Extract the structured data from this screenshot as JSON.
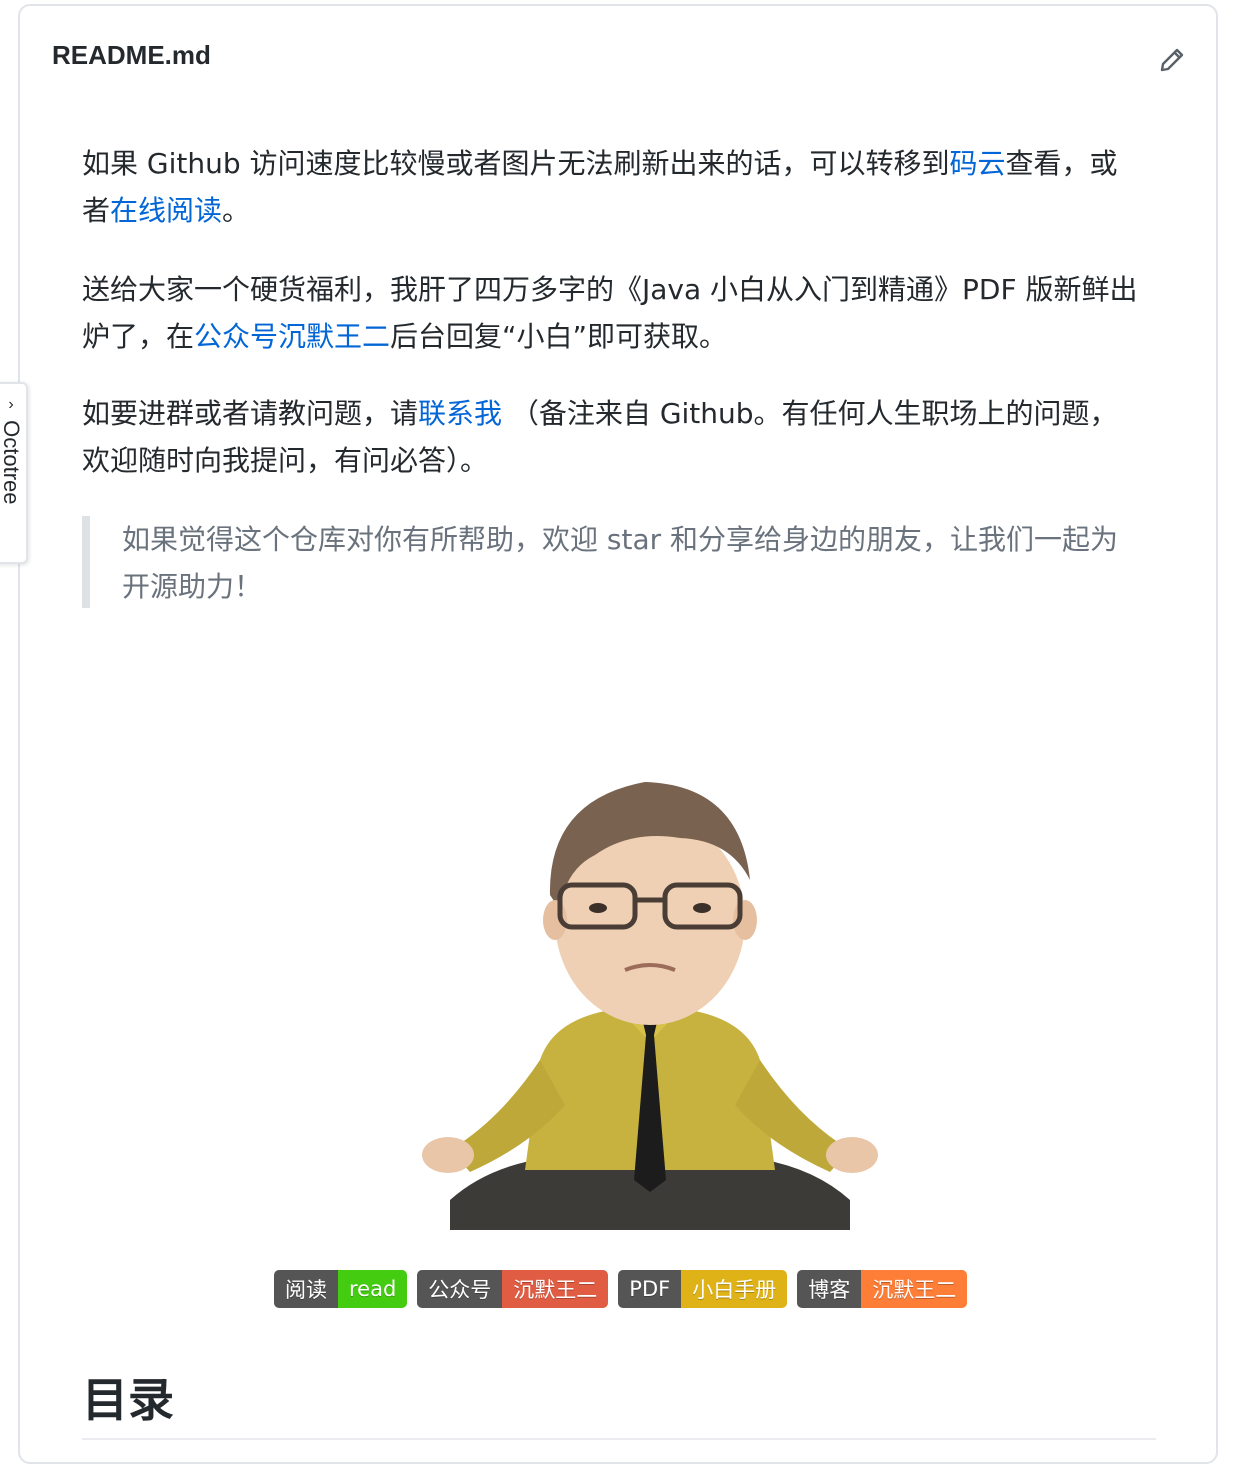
{
  "readme": {
    "filename": "README.md",
    "edit_icon": "pencil-icon"
  },
  "octotree": {
    "label": "Octotree",
    "icon": "chevron-right-icon"
  },
  "intro": {
    "p1_text1": "如果 Github 访问速度比较慢或者图片无法刷新出来的话，可以转移到",
    "p1_link1": "码云",
    "p1_text2": "查看，或者",
    "p1_link2": "在线阅读",
    "p1_text3": "。",
    "p2_text1": "送给大家一个硬货福利，我肝了四万多字的《Java 小白从入门到精通》PDF 版新鲜出炉了，在",
    "p2_link": "公众号沉默王二",
    "p2_text2": "后台回复“小白”即可获取。",
    "p3_text1": "如要进群或者请教问题，请",
    "p3_link": "联系我",
    "p3_text2": " （备注来自 Github。有任何人生职场上的问题，欢迎随时向我提问，有问必答）。"
  },
  "quote": "如果觉得这个仓库对你有所帮助，欢迎 star 和分享给身边的朋友，让我们一起为开源助力！",
  "badges": [
    {
      "left": "阅读",
      "right": "read",
      "color": "#4c1"
    },
    {
      "left": "公众号",
      "right": "沉默王二",
      "color": "#e05d44"
    },
    {
      "left": "PDF",
      "right": "小白手册",
      "color": "#dfb317"
    },
    {
      "left": "博客",
      "right": "沉默王二",
      "color": "#fe7d37"
    }
  ],
  "toc_heading": "目录",
  "colors": {
    "link": "#0366d6",
    "quote_text": "#6a737d",
    "quote_border": "#dfe2e5"
  }
}
